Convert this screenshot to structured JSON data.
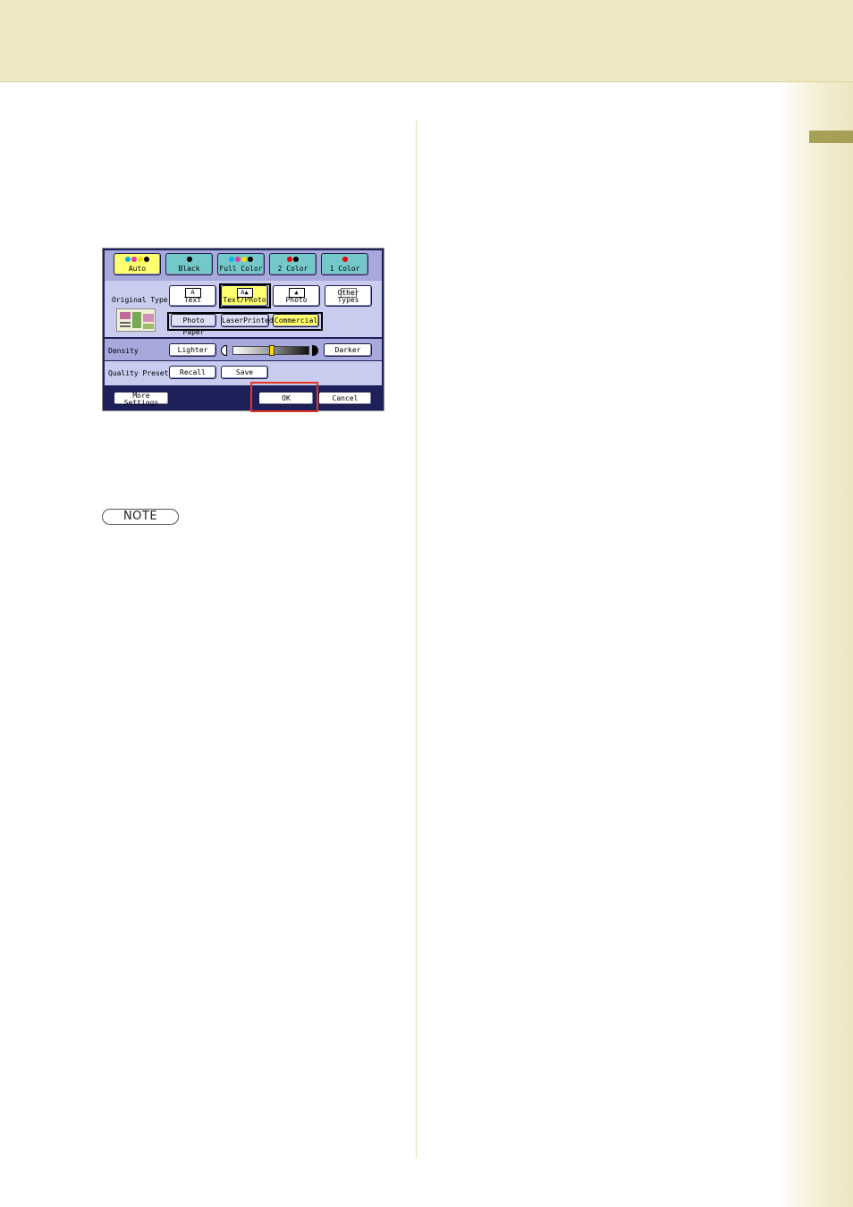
{
  "panel": {
    "color_modes": [
      {
        "label": "Auto",
        "selected": true,
        "dots": [
          "#00b5e8",
          "#e83aa5",
          "#f0e000",
          "#000000"
        ]
      },
      {
        "label": "Black",
        "selected": false,
        "dots": [
          "#000000"
        ]
      },
      {
        "label": "Full Color",
        "selected": false,
        "dots": [
          "#00b5e8",
          "#e83aa5",
          "#f0e000",
          "#000000"
        ]
      },
      {
        "label": "2 Color",
        "selected": false,
        "dots": [
          "#e60012",
          "#000000"
        ]
      },
      {
        "label": "1 Color",
        "selected": false,
        "dots": [
          "#e60012"
        ]
      }
    ],
    "original_type_label": "Original Type",
    "original_types": [
      {
        "label": "Text",
        "icon": "A",
        "selected": false
      },
      {
        "label": "Text/Photo",
        "icon": "A▲",
        "selected": true
      },
      {
        "label": "Photo",
        "icon": "▲",
        "selected": false
      },
      {
        "label": "Other Types",
        "icon": "",
        "selected": false
      }
    ],
    "sub_types": [
      {
        "label": "Photo Paper",
        "selected": false
      },
      {
        "label": "LaserPrinted",
        "selected": false
      },
      {
        "label": "Commercial",
        "selected": true
      }
    ],
    "density_label": "Density",
    "lighter_label": "Lighter",
    "darker_label": "Darker",
    "density_level": 0.5,
    "quality_presets_label": "Quality Presets",
    "recall_label": "Recall",
    "save_label": "Save",
    "more_settings_label": "More Settings",
    "ok_label": "OK",
    "cancel_label": "Cancel"
  },
  "note": {
    "label": "NOTE"
  },
  "colors": {
    "header": "#efe8c4",
    "accent_tab": "#a5a055",
    "selected_button": "#ffff70",
    "color_button": "#74c8c9",
    "highlight": "#e8341c"
  }
}
